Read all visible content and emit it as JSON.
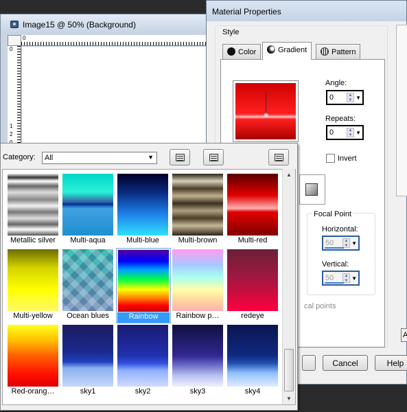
{
  "image_window": {
    "title": "Image15 @  50% (Background)",
    "ruler_top_zero": "0",
    "ruler_left_marks": [
      "0",
      "1",
      "2",
      "0"
    ]
  },
  "dialog": {
    "title": "Material Properties",
    "style_label": "Style",
    "tabs": [
      {
        "label": "Color",
        "icon": "color-circle-icon"
      },
      {
        "label": "Gradient",
        "icon": "gradient-circle-icon"
      },
      {
        "label": "Pattern",
        "icon": "pattern-icon"
      }
    ],
    "active_tab": "Gradient",
    "angle_label": "Angle:",
    "angle_value": "0",
    "repeats_label": "Repeats:",
    "repeats_value": "0",
    "invert_label": "Invert",
    "invert_checked": false,
    "focal_point_label": "Focal Point",
    "horizontal_label": "Horizontal:",
    "horizontal_value": "50",
    "vertical_label": "Vertical:",
    "vertical_value": "50",
    "focal_points_text": "cal points",
    "cancel_label": "Cancel",
    "help_label": "Help",
    "right_button_label": "A"
  },
  "picker": {
    "category_label": "Category:",
    "category_value": "All",
    "gradients": [
      {
        "name": "Metallic silver",
        "class": "g-metallic"
      },
      {
        "name": "Multi-aqua",
        "class": "g-aqua"
      },
      {
        "name": "Multi-blue",
        "class": "g-blue"
      },
      {
        "name": "Multi-brown",
        "class": "g-brown"
      },
      {
        "name": "Multi-red",
        "class": "g-red"
      },
      {
        "name": "Multi-yellow",
        "class": "g-yellow"
      },
      {
        "name": "Ocean blues",
        "class": "g-ocean"
      },
      {
        "name": "Rainbow",
        "class": "g-rainbow"
      },
      {
        "name": "Rainbow p…",
        "class": "g-rainbowp"
      },
      {
        "name": "redeye",
        "class": "g-redeye"
      },
      {
        "name": "Red-orang…",
        "class": "g-redorange"
      },
      {
        "name": "sky1",
        "class": "g-sky1"
      },
      {
        "name": "sky2",
        "class": "g-sky2"
      },
      {
        "name": "sky3",
        "class": "g-sky3"
      },
      {
        "name": "sky4",
        "class": "g-sky4"
      }
    ],
    "selected": "Rainbow"
  },
  "colors": {
    "selection_highlight": "#3399ff",
    "dialog_bg": "#f0f0f0",
    "desktop_bg": "#2b2b2b"
  }
}
